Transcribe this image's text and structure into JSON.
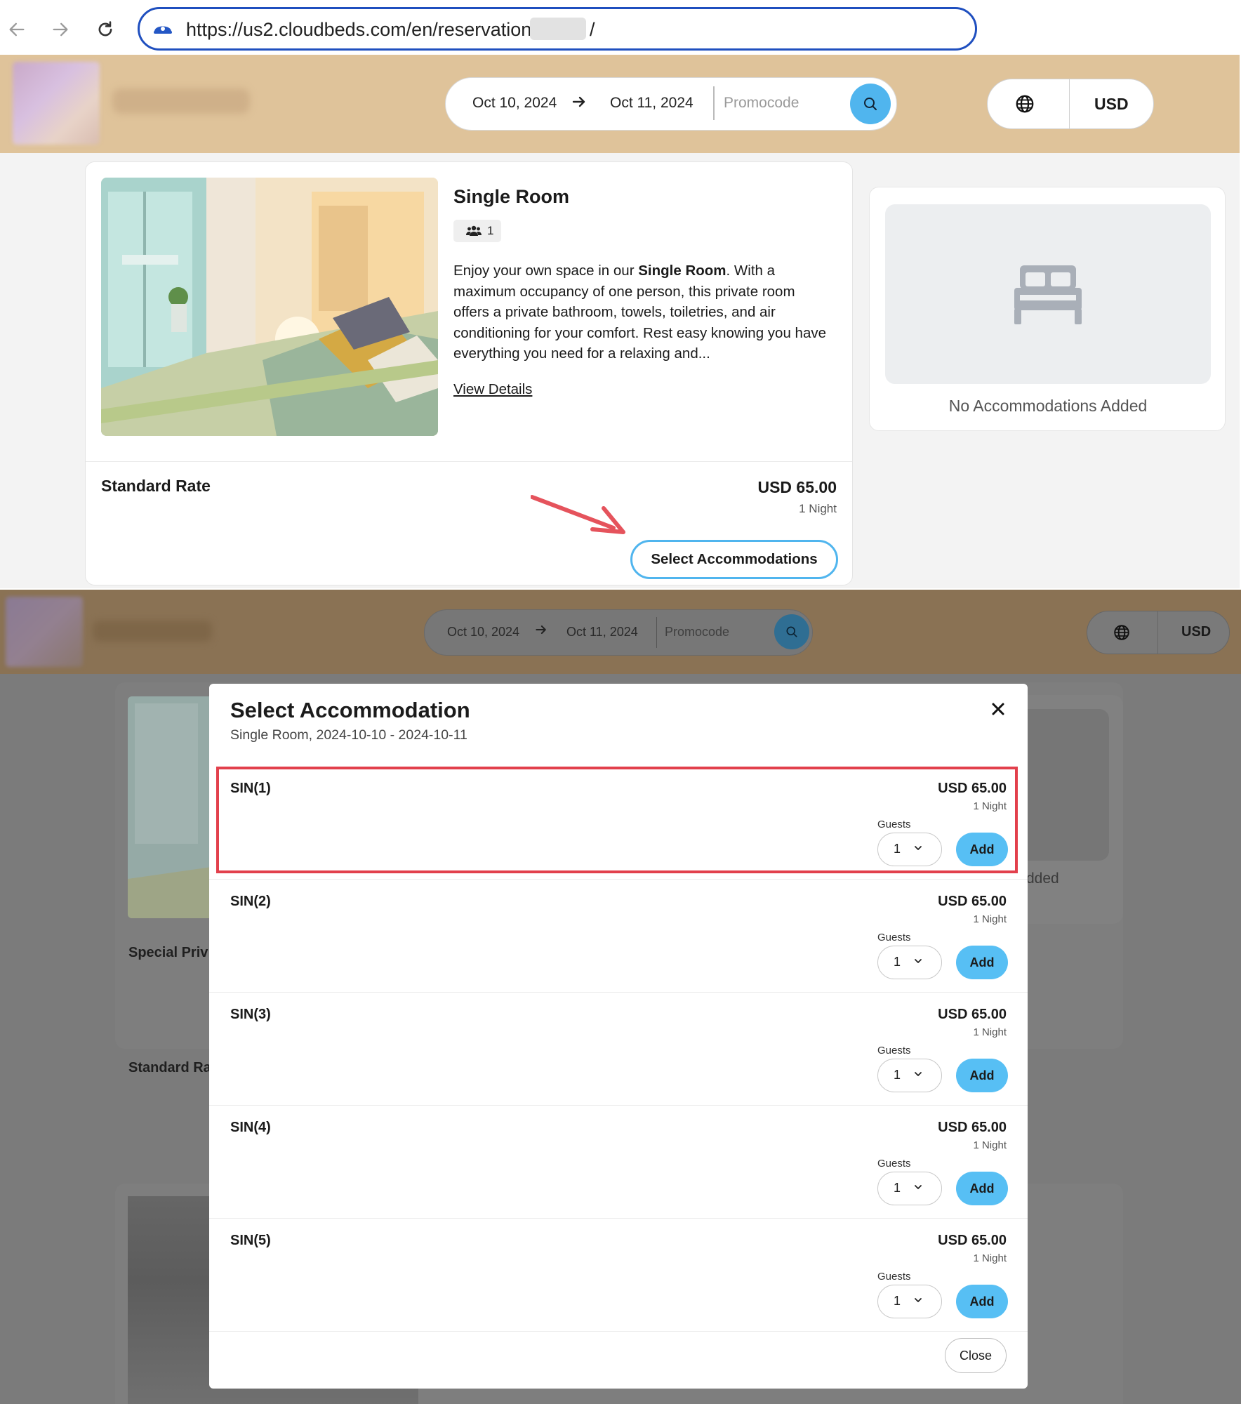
{
  "browser": {
    "url_prefix": "https://us2.cloudbeds.com/en/reservation/",
    "url_suffix": "/",
    "icons": [
      "back-arrow-icon",
      "forward-arrow-icon",
      "reload-icon",
      "site-icon"
    ]
  },
  "header": {
    "check_in": "Oct 10, 2024",
    "check_out": "Oct 11, 2024",
    "promo_placeholder": "Promocode",
    "currency": "USD",
    "colors": {
      "header_bg": "#dfc39a",
      "accent": "#50b5ee"
    }
  },
  "room": {
    "title": "Single Room",
    "occupancy": "1",
    "desc_intro": "Enjoy your own space in our ",
    "desc_bold": "Single Room",
    "desc_rest": ". With a maximum occupancy of one person, this private room offers a private bathroom, towels, toiletries, and air conditioning for your comfort. Rest easy knowing you have everything you need for a relaxing and...",
    "view_details": "View Details",
    "rate_name": "Standard Rate",
    "rate_price": "USD 65.00",
    "rate_nights": "1 Night",
    "select_button": "Select Accommodations"
  },
  "sidebar": {
    "empty_text": "No Accommodations Added"
  },
  "background": {
    "label_1": "Special Priv",
    "label_2": "Standard Ra",
    "side_text": "dded"
  },
  "modal": {
    "title": "Select Accommodation",
    "subtitle": "Single Room, 2024-10-10 - 2024-10-11",
    "guests_label": "Guests",
    "add_label": "Add",
    "close_label": "Close",
    "rows": [
      {
        "name": "SIN(1)",
        "price": "USD 65.00",
        "nights": "1 Night",
        "guests": "1"
      },
      {
        "name": "SIN(2)",
        "price": "USD 65.00",
        "nights": "1 Night",
        "guests": "1"
      },
      {
        "name": "SIN(3)",
        "price": "USD 65.00",
        "nights": "1 Night",
        "guests": "1"
      },
      {
        "name": "SIN(4)",
        "price": "USD 65.00",
        "nights": "1 Night",
        "guests": "1"
      },
      {
        "name": "SIN(5)",
        "price": "USD 65.00",
        "nights": "1 Night",
        "guests": "1"
      }
    ],
    "colors": {
      "highlight": "#e2404c",
      "add_button": "#57bff4"
    }
  }
}
